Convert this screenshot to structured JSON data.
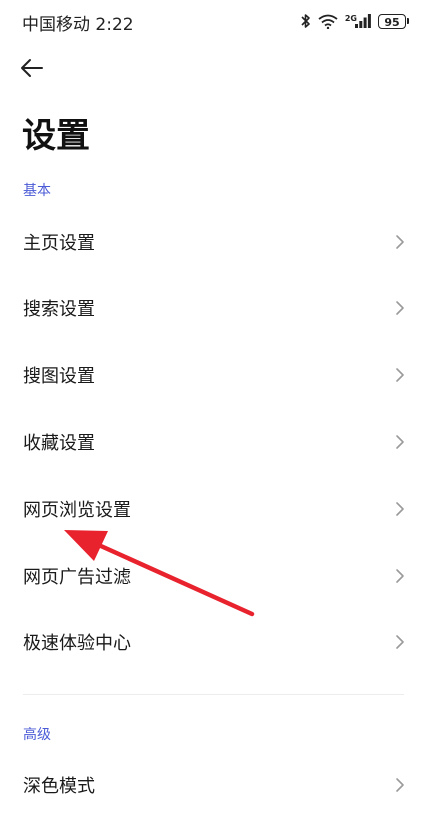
{
  "status_bar": {
    "carrier_time": "中国移动 2:22",
    "network_label": "2G",
    "battery_level": "95"
  },
  "header": {
    "title": "设置"
  },
  "sections": [
    {
      "header": "基本",
      "items": [
        {
          "label": "主页设置"
        },
        {
          "label": "搜索设置"
        },
        {
          "label": "搜图设置"
        },
        {
          "label": "收藏设置"
        },
        {
          "label": "网页浏览设置"
        },
        {
          "label": "网页广告过滤"
        },
        {
          "label": "极速体验中心"
        }
      ]
    },
    {
      "header": "高级",
      "items": [
        {
          "label": "深色模式"
        }
      ]
    }
  ],
  "colors": {
    "section_header": "#4b5bd6",
    "annotation_arrow": "#e8232e"
  },
  "icons": {
    "back": "arrow-left-icon",
    "chevron": "chevron-right-icon"
  }
}
